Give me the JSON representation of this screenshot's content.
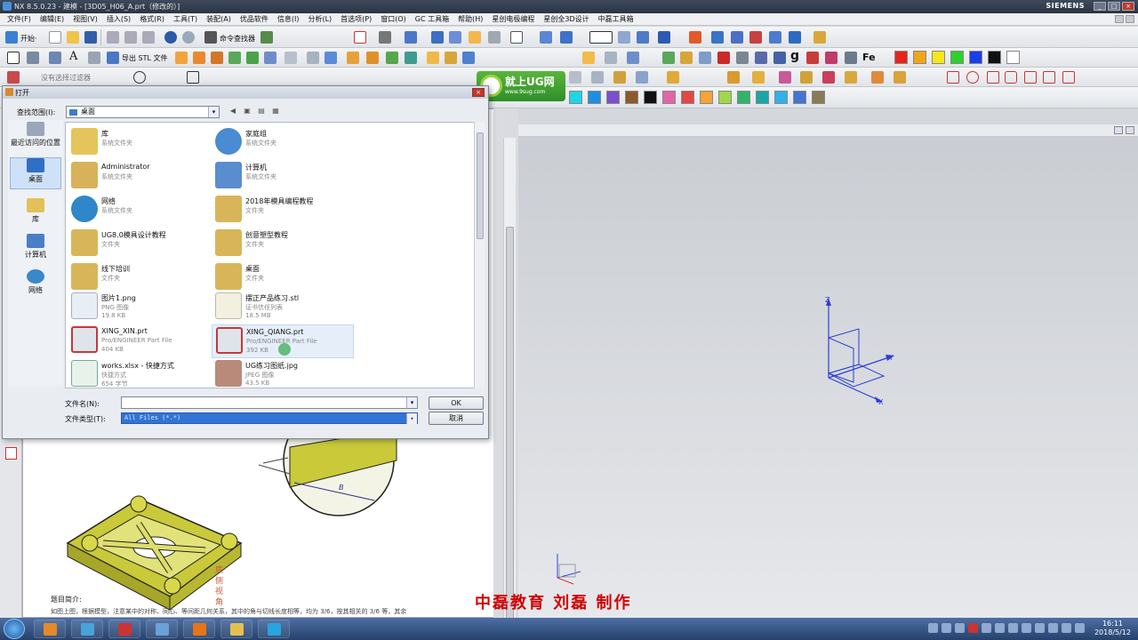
{
  "window": {
    "title": "NX 8.5.0.23 - 建模 - [3D05_H06_A.prt（修改的）]",
    "brand": "SIEMENS"
  },
  "menubar": [
    "文件(F)",
    "编辑(E)",
    "视图(V)",
    "插入(S)",
    "格式(R)",
    "工具(T)",
    "装配(A)",
    "优品软件",
    "信息(I)",
    "分析(L)",
    "首选项(P)",
    "窗口(O)",
    "GC 工具箱",
    "帮助(H)",
    "星创电极编程",
    "星创全3D设计",
    "中磊工具箱"
  ],
  "toolbar": {
    "start_label": "开始·",
    "cmd_finder": "命令查找器",
    "export_stl": "导出 STL 文件",
    "partial_text": "没有选择过滤器"
  },
  "colors": {
    "palette_row1": [
      "#e8231c",
      "#f2a51a",
      "#f6e81a",
      "#2ed12b",
      "#1a3ee8",
      "#111111",
      "#ffffff"
    ],
    "palette_row2": [
      "#1dd5e8",
      "#1e8fe0",
      "#7a4fd0",
      "#8c5a2b",
      "#111111",
      "#e066a8",
      "#e04848",
      "#f2a33a",
      "#9ed84a",
      "#2fb46c",
      "#1aa6a6",
      "#31b1e8",
      "#4473d1",
      "#8a7a58"
    ]
  },
  "logo": {
    "title": "就上UG网",
    "url": "www.9sug.com"
  },
  "dialog": {
    "title": "打开",
    "lookin_label": "查找范围(I):",
    "lookin_value": "桌面",
    "places": [
      "最近访问的位置",
      "桌面",
      "库",
      "计算机",
      "网络"
    ],
    "files": [
      {
        "name": "库",
        "type": "系统文件夹",
        "size": ""
      },
      {
        "name": "家庭组",
        "type": "系统文件夹",
        "size": ""
      },
      {
        "name": "Administrator",
        "type": "系统文件夹",
        "size": ""
      },
      {
        "name": "计算机",
        "type": "系统文件夹",
        "size": ""
      },
      {
        "name": "网络",
        "type": "系统文件夹",
        "size": ""
      },
      {
        "name": "2018年模具编程教程",
        "type": "文件夹",
        "size": ""
      },
      {
        "name": "UG8.0模具设计教程",
        "type": "文件夹",
        "size": ""
      },
      {
        "name": "创意塑型教程",
        "type": "文件夹",
        "size": ""
      },
      {
        "name": "线下培训",
        "type": "文件夹",
        "size": ""
      },
      {
        "name": "桌面",
        "type": "文件夹",
        "size": ""
      },
      {
        "name": "图片1.png",
        "type": "PNG 图像",
        "size": "19.8 KB"
      },
      {
        "name": "摆正产品练习.stl",
        "type": "证书信任列表",
        "size": "18.5 MB"
      },
      {
        "name": "XING_XIN.prt",
        "type": "Pro/ENGINEER Part File",
        "size": "404 KB"
      },
      {
        "name": "XING_QIANG.prt",
        "type": "Pro/ENGINEER Part File",
        "size": "392 KB"
      },
      {
        "name": "works.xlsx - 快捷方式",
        "type": "快捷方式",
        "size": "654 字节"
      },
      {
        "name": "UG练习图纸.jpg",
        "type": "JPEG 图像",
        "size": "43.5 KB"
      }
    ],
    "filename_label": "文件名(N):",
    "filename_value": "",
    "filetype_label": "文件类型(T):",
    "filetype_value": "All Files (*.*)",
    "ok_label": "OK",
    "cancel_label": "取消"
  },
  "document": {
    "view_label": "底侧视角",
    "intro_label": "题目简介:",
    "intro_text": "如图上图，根据模型，注意某中的对称、同心、等间距几何关系，其中的角与切线长度相等，均为 3/6，按其相关的 3/6 等，其余"
  },
  "watermark": "中磊教育 刘磊 制作",
  "axes": {
    "z": "Z",
    "y": "Y",
    "x": "X"
  },
  "taskbar": {
    "time": "16:11",
    "date": "2018/5/12"
  }
}
